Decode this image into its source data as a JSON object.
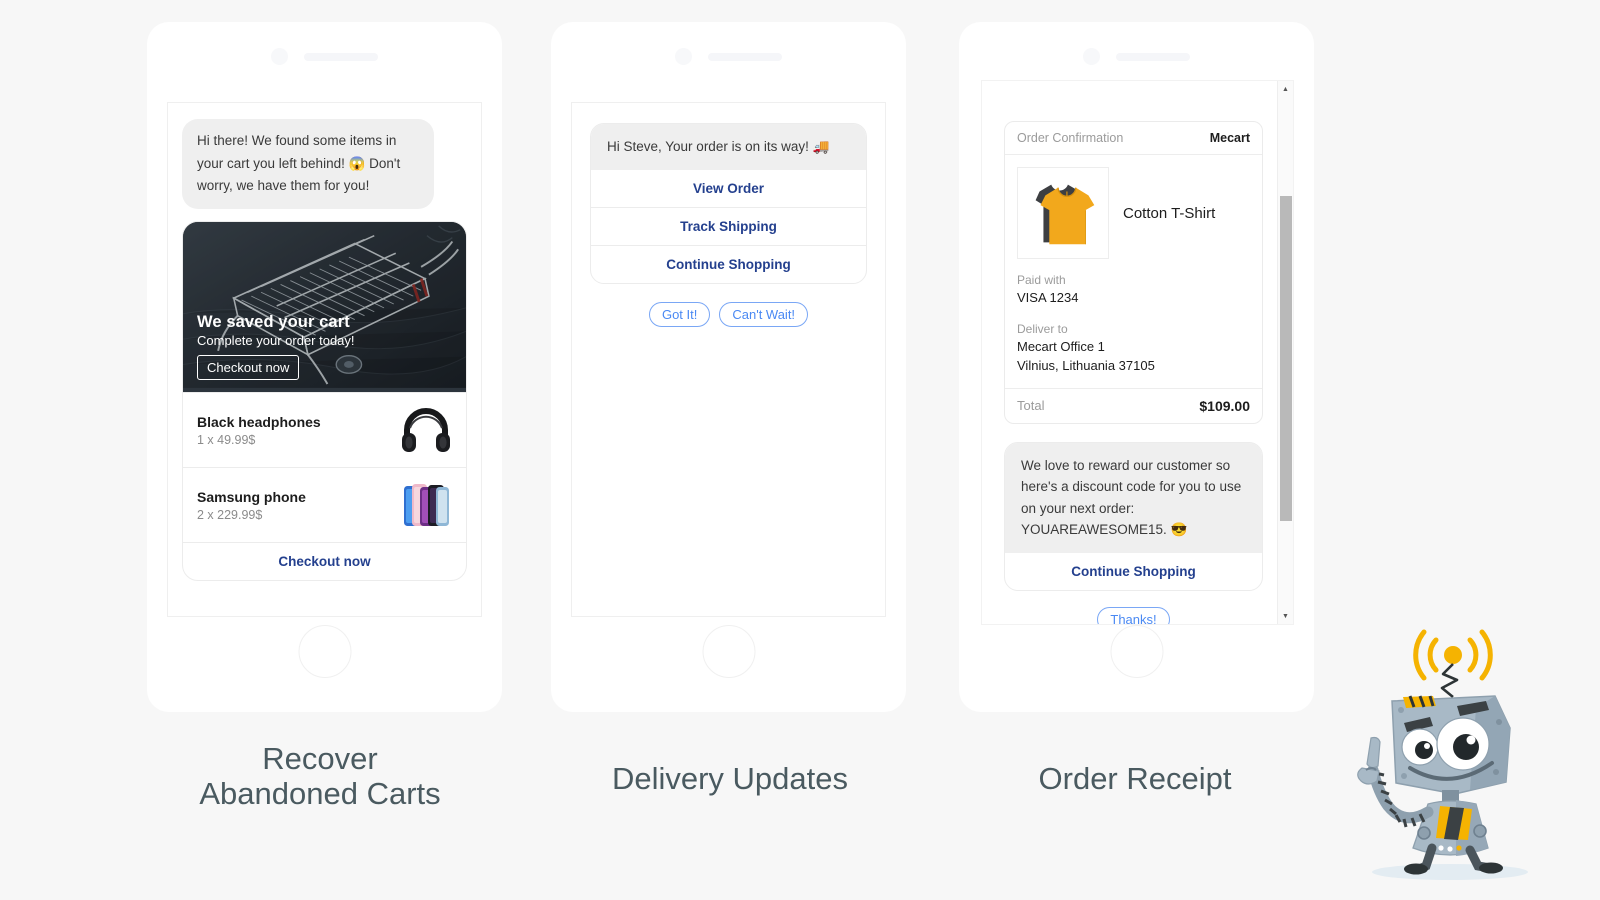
{
  "page": {
    "background_color": "#f7f7f7",
    "accent_blue": "#24408e",
    "quick_reply_blue": "#4a89f3",
    "brand_yellow": "#f5b301"
  },
  "panels": [
    {
      "id": "recover-abandoned-carts",
      "caption_line_1": "Recover",
      "caption_line_2": "Abandoned Carts",
      "greeting": "Hi there! We found some items in your cart you left behind! 😱 Don't worry, we have them for you!",
      "hero": {
        "title": "We saved your cart",
        "subtitle": "Complete your order today!",
        "cta": "Checkout now",
        "image_alt": "abandoned-shopping-cart"
      },
      "products": [
        {
          "name": "Black headphones",
          "qty_price": "1 x 49.99$",
          "thumb": "headphones-thumb"
        },
        {
          "name": "Samsung phone",
          "qty_price": "2 x 229.99$",
          "thumb": "samsung-phone-thumb"
        }
      ],
      "footer_button": "Checkout now"
    },
    {
      "id": "delivery-updates",
      "caption_line_1": "Delivery Updates",
      "caption_line_2": "",
      "greeting": "Hi Steve, Your order is on its way! 🚚",
      "buttons": [
        "View Order",
        "Track Shipping",
        "Continue Shopping"
      ],
      "quick_replies": [
        "Got It!",
        "Can't Wait!"
      ]
    },
    {
      "id": "order-receipt",
      "caption_line_1": "Order Receipt",
      "caption_line_2": "",
      "receipt": {
        "header_label": "Order Confirmation",
        "brand": "Mecart",
        "item_name": "Cotton T-Shirt",
        "item_thumb": "cotton-tshirt-thumb",
        "paid_with_label": "Paid with",
        "paid_with_value": "VISA 1234",
        "deliver_to_label": "Deliver to",
        "deliver_to_line_1": "Mecart Office 1",
        "deliver_to_line_2": "Vilnius, Lithuania 37105",
        "total_label": "Total",
        "total_value": "$109.00"
      },
      "discount_message": "We love to reward our customer so here's a discount code for you to use on your next order: YOUAREAWESOME15. 😎",
      "discount_button": "Continue Shopping",
      "quick_replies": [
        "Thanks!"
      ],
      "scrollbar": {
        "up_arrow": "▲",
        "down_arrow": "▼"
      }
    }
  ],
  "mascot": {
    "name": "mecart-robot-mascot",
    "signal": "wifi-signal-icon"
  }
}
